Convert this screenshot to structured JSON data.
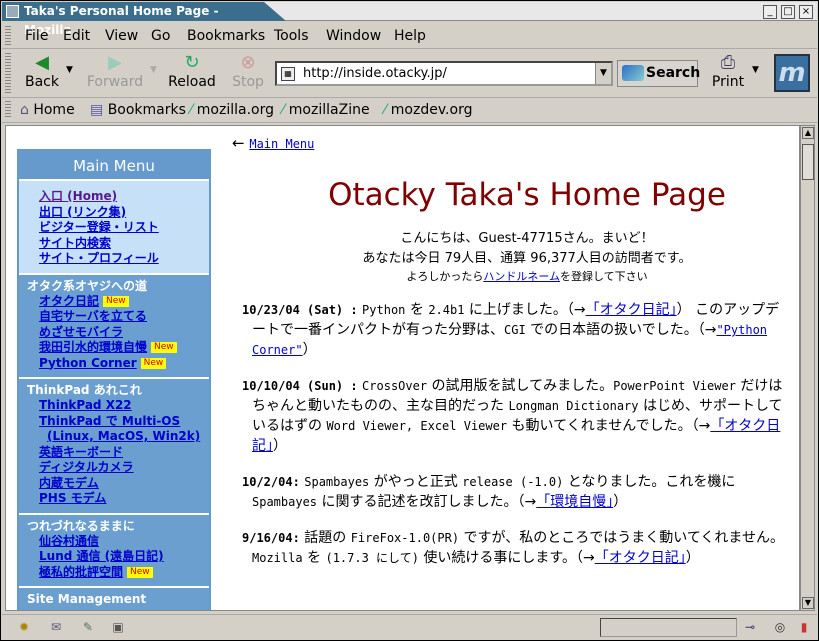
{
  "window": {
    "title": "Taka's Personal Home Page - Mozilla",
    "controls": [
      "_",
      "□",
      "×"
    ]
  },
  "menubar": [
    "File",
    "Edit",
    "View",
    "Go",
    "Bookmarks",
    "Tools",
    "Window",
    "Help"
  ],
  "nav": {
    "back": "Back",
    "forward": "Forward",
    "reload": "Reload",
    "stop": "Stop",
    "url": "http://inside.otacky.jp/",
    "search": "Search",
    "print": "Print"
  },
  "bookmarks": [
    "Home",
    "Bookmarks",
    "mozilla.org",
    "mozillaZine",
    "mozdev.org"
  ],
  "sidebar": {
    "title": "Main Menu",
    "sections": [
      {
        "title": "",
        "items": [
          {
            "label": "入口 (Home)",
            "new": false,
            "visited": true
          },
          {
            "label": "出口 (リンク集)",
            "new": false
          },
          {
            "label": "ビジター登録・リスト",
            "new": false
          },
          {
            "label": "サイト内検索",
            "new": false
          },
          {
            "label": "サイト・プロフィール",
            "new": false
          }
        ]
      },
      {
        "title": "オタク系オヤジへの道",
        "items": [
          {
            "label": "オタク日記",
            "new": true
          },
          {
            "label": "自宅サーバを立てる",
            "new": false
          },
          {
            "label": "めざせモバイラ",
            "new": false
          },
          {
            "label": "我田引水的環境自慢",
            "new": true
          },
          {
            "label": "Python Corner",
            "new": true
          }
        ]
      },
      {
        "title": "ThinkPad あれこれ",
        "items": [
          {
            "label": "ThinkPad X22",
            "new": false
          },
          {
            "label": "ThinkPad で Multi-OS",
            "new": false
          },
          {
            "label": "(Linux, MacOS, Win2k)",
            "new": false,
            "sub": true
          },
          {
            "label": "英語キーボード",
            "new": false
          },
          {
            "label": "ディジタルカメラ",
            "new": false
          },
          {
            "label": "内蔵モデム",
            "new": false
          },
          {
            "label": "PHS モデム",
            "new": false
          }
        ]
      },
      {
        "title": "つれづれなるままに",
        "items": [
          {
            "label": "仙谷村通信",
            "new": false
          },
          {
            "label": "Lund 通信 (遠島日記)",
            "new": false
          },
          {
            "label": "極私的批評空間",
            "new": true
          }
        ]
      },
      {
        "title": "Site Management",
        "items": []
      }
    ],
    "new_badge": "New"
  },
  "main": {
    "back_arrow": "←",
    "back_link": "Main Menu",
    "title": "Otacky Taka's Home Page",
    "greeting1": "こんにちは、Guest-47715さん。まいど！",
    "greeting2": "あなたは今日 79人目、通算 96,377人目の訪問者です。",
    "register_pre": "よろしかったら",
    "register_link": "ハンドルネーム",
    "register_post": "を登録して下さい",
    "news": [
      {
        "date": "10/23/04 (Sat) :",
        "segments": [
          {
            "t": " "
          },
          {
            "t": "Python",
            "m": true
          },
          {
            "t": " を "
          },
          {
            "t": "2.4b1",
            "m": true
          },
          {
            "t": " に上げました。（→"
          },
          {
            "t": "「オタク日記」",
            "link": true
          },
          {
            "t": "） このアップデートで一番インパクトが有った分野は、"
          },
          {
            "t": "CGI",
            "m": true
          },
          {
            "t": " での日本語の扱いでした。（→"
          },
          {
            "t": "\"Python Corner\"",
            "link": true,
            "m": true
          },
          {
            "t": "）"
          }
        ]
      },
      {
        "date": "10/10/04 (Sun) :",
        "segments": [
          {
            "t": " "
          },
          {
            "t": "CrossOver",
            "m": true
          },
          {
            "t": " の試用版を試してみました。"
          },
          {
            "t": "PowerPoint Viewer",
            "m": true
          },
          {
            "t": " だけはちゃんと動いたものの、主な目的だった "
          },
          {
            "t": "Longman Dictionary",
            "m": true
          },
          {
            "t": " はじめ、サポートしているはずの "
          },
          {
            "t": "Word Viewer, Excel Viewer",
            "m": true
          },
          {
            "t": " も動いてくれませんでした。（→"
          },
          {
            "t": "「オタク日記」",
            "link": true
          },
          {
            "t": "）"
          }
        ]
      },
      {
        "date": "10/2/04:",
        "segments": [
          {
            "t": " "
          },
          {
            "t": "Spambayes",
            "m": true
          },
          {
            "t": " がやっと正式 "
          },
          {
            "t": "release (-1.0)",
            "m": true
          },
          {
            "t": " となりました。これを機に "
          },
          {
            "t": "Spambayes",
            "m": true
          },
          {
            "t": " に関する記述を改訂しました。（→"
          },
          {
            "t": "「環境自慢」",
            "link": true
          },
          {
            "t": "）"
          }
        ]
      },
      {
        "date": "9/16/04:",
        "segments": [
          {
            "t": " 話題の "
          },
          {
            "t": "FireFox-1.0(PR)",
            "m": true
          },
          {
            "t": " ですが、私のところではうまく動いてくれません。"
          },
          {
            "t": "Mozilla",
            "m": true
          },
          {
            "t": " を "
          },
          {
            "t": "(1.7.3 にして)",
            "m": true
          },
          {
            "t": " 使い続ける事にします。（→"
          },
          {
            "t": "「オタク日記」",
            "link": true
          },
          {
            "t": "）"
          }
        ]
      }
    ]
  }
}
